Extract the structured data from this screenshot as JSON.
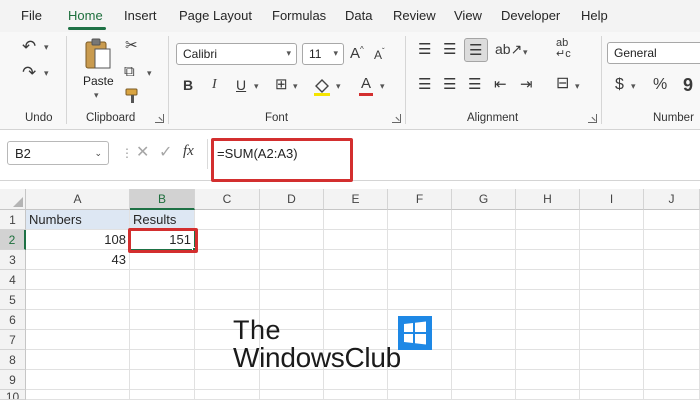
{
  "menu": {
    "tabs": [
      {
        "label": "File"
      },
      {
        "label": "Home",
        "active": true
      },
      {
        "label": "Insert"
      },
      {
        "label": "Page Layout"
      },
      {
        "label": "Formulas"
      },
      {
        "label": "Data"
      },
      {
        "label": "Review"
      },
      {
        "label": "View"
      },
      {
        "label": "Developer"
      },
      {
        "label": "Help"
      }
    ]
  },
  "ribbon": {
    "undo_group_label": "Undo",
    "clipboard": {
      "group_label": "Clipboard",
      "paste_label": "Paste"
    },
    "font": {
      "group_label": "Font",
      "font_name": "Calibri",
      "font_size": "11"
    },
    "alignment": {
      "group_label": "Alignment"
    },
    "number": {
      "group_label": "Number",
      "format": "General"
    }
  },
  "formula_bar": {
    "name_box": "B2",
    "fx_symbol": "fx",
    "formula": "=SUM(A2:A3)"
  },
  "sheet": {
    "columns": [
      "A",
      "B",
      "C",
      "D",
      "E",
      "F",
      "G",
      "H",
      "I",
      "J"
    ],
    "rows": [
      "1",
      "2",
      "3",
      "4",
      "5",
      "6",
      "7",
      "8",
      "9",
      "10"
    ],
    "selected_cell": "B2",
    "cells": {
      "A1": "Numbers",
      "B1": "Results",
      "A2": "108",
      "B2": "151",
      "A3": "43"
    }
  },
  "watermark": {
    "line1": "The",
    "line2": "WindowsClub"
  },
  "colors": {
    "accent": "#1e7145",
    "highlight_box": "#d32f2f",
    "header_fill": "#dde7f3",
    "logo_blue": "#1e88e5"
  }
}
